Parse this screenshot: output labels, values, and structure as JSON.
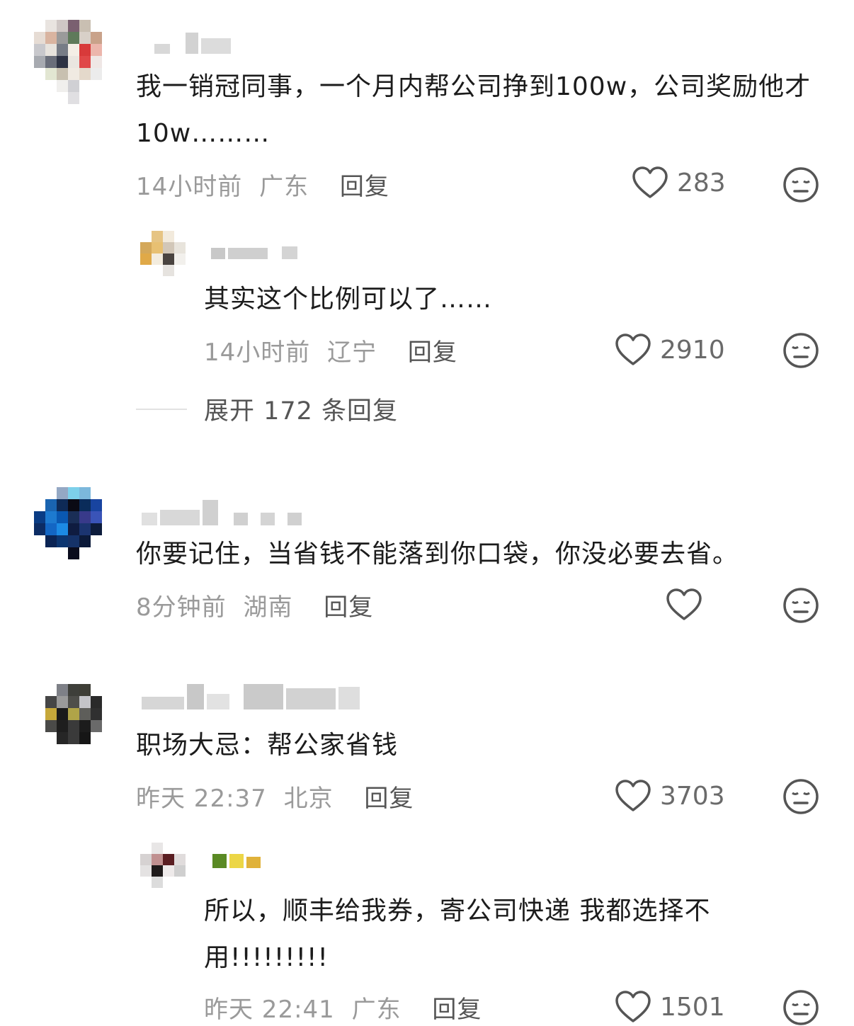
{
  "comments": [
    {
      "text": "我一销冠同事，一个月内帮公司挣到100w，公司奖励他才10w………",
      "time": "14小时前",
      "location": "广东",
      "reply_label": "回复",
      "likes": "283"
    },
    {
      "text": "你要记住，当省钱不能落到你口袋，你没必要去省。",
      "time": "8分钟前",
      "location": "湖南",
      "reply_label": "回复",
      "likes": ""
    },
    {
      "text": "职场大忌：帮公家省钱",
      "time": "昨天 22:37",
      "location": "北京",
      "reply_label": "回复",
      "likes": "3703"
    }
  ],
  "replies": [
    {
      "text": "其实这个比例可以了……",
      "time": "14小时前",
      "location": "辽宁",
      "reply_label": "回复",
      "likes": "2910"
    },
    {
      "text": "所以，顺丰给我券，寄公司快递 我都选择不用!!!!!!!!!",
      "time": "昨天 22:41",
      "location": "广东",
      "reply_label": "回复",
      "likes": "1501"
    }
  ],
  "expand_replies_label": "展开 172 条回复",
  "icons": {
    "like": "heart-outline-icon",
    "react": "neutral-face-icon"
  },
  "colors": {
    "text": "#1c1c1c",
    "meta": "#9a9a9a",
    "icon": "#555555"
  }
}
